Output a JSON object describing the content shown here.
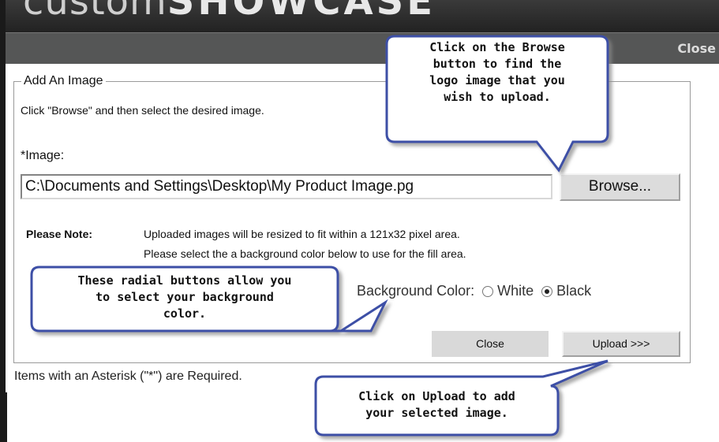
{
  "logo": {
    "prefix": "custom",
    "suffix": "SHOWCASE"
  },
  "header": {
    "close_label": "Close"
  },
  "form": {
    "legend": "Add An Image",
    "instructions": "Click \"Browse\" and then select the desired image.",
    "image_label": "*Image:",
    "file_value": "C:\\Documents and Settings\\Desktop\\My Product Image.pg",
    "browse_label": "Browse...",
    "note_label": "Please Note:",
    "note_line1": "Uploaded images will be resized to fit within a 121x32 pixel area.",
    "note_line2": "Please select the a background color below to use for the fill area.",
    "bg_label": "Background Color:",
    "options": [
      {
        "label": "White",
        "checked": false
      },
      {
        "label": "Black",
        "checked": true
      }
    ],
    "close_label": "Close",
    "upload_label": "Upload >>>",
    "required_note": "Items with an Asterisk (\"*\") are Required."
  },
  "callouts": {
    "browse": [
      "Click on the Browse",
      "button to find the",
      "logo image that you",
      "wish to upload."
    ],
    "radio": [
      "These radial buttons allow you",
      "to select your background",
      "color."
    ],
    "upload": [
      "Click on Upload to add",
      "your selected image."
    ]
  }
}
